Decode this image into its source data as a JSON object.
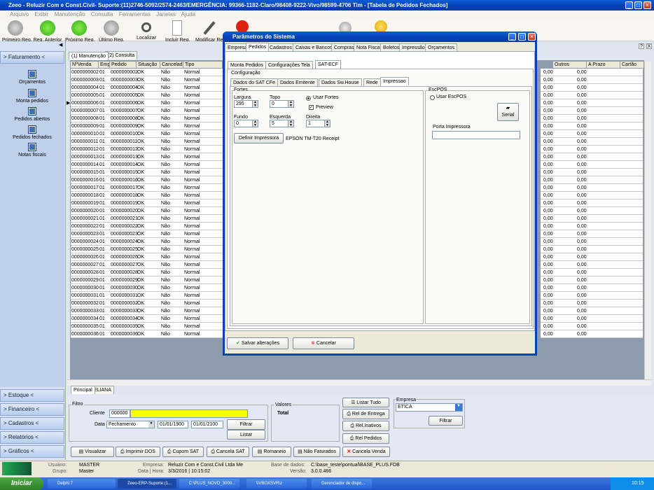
{
  "window": {
    "title": "Zeeo - Reluzir Com e Const.Civil- Suporte:(11)2746-5092/2574-2463/EMERGÊNCIA: 99366-1182-Claro/98408-9222-Vivo/98599-4706 Tim - [Tabela de Pedidos Fechados]"
  },
  "menu": [
    "Arquivo",
    "Exibir",
    "Manutenção",
    "Consulta",
    "Ferramentas",
    "Janelas",
    "Ajuda"
  ],
  "toolbar": [
    "Primeiro Reg.",
    "Reg. Anterior",
    "Próximo Reg.",
    "Último Reg.",
    "Localizar",
    "Incluir Reg.",
    "Modificar Reg"
  ],
  "sidebar": {
    "header": "> Faturamento <",
    "items": [
      "Orçamentos",
      "Monta pedidos",
      "Pedidos abertos",
      "Pedidos fechados",
      "Notas fiscais"
    ],
    "bottom": [
      "> Estoque <",
      "> Financeiro <",
      "> Cadastros <",
      "> Relatórios <",
      "> Gráficos <"
    ]
  },
  "main_tabs": [
    "(1) Manutenção",
    "(2) Consulta"
  ],
  "grid": {
    "columns": [
      "NºVenda",
      "Emp",
      "Pedido",
      "Situação",
      "Cancelada",
      "Tipo"
    ],
    "rows": [
      [
        "0000000002",
        "01",
        "0000000002",
        "OK",
        "Não",
        "Normal"
      ],
      [
        "0000000003",
        "01",
        "0000000003",
        "OK",
        "Não",
        "Normal"
      ],
      [
        "0000000004",
        "01",
        "0000000004",
        "OK",
        "Não",
        "Normal"
      ],
      [
        "0000000005",
        "01",
        "0000000005",
        "OK",
        "Não",
        "Normal"
      ],
      [
        "0000000006",
        "01",
        "0000000006",
        "OK",
        "Não",
        "Normal"
      ],
      [
        "0000000007",
        "01",
        "0000000007",
        "OK",
        "Não",
        "Normal"
      ],
      [
        "0000000008",
        "01",
        "0000000008",
        "OK",
        "Não",
        "Normal"
      ],
      [
        "0000000009",
        "01",
        "0000000009",
        "OK",
        "Não",
        "Normal"
      ],
      [
        "0000000010",
        "01",
        "0000000010",
        "OK",
        "Não",
        "Normal"
      ],
      [
        "0000000011",
        "01",
        "0000000011",
        "OK",
        "Não",
        "Normal"
      ],
      [
        "0000000012",
        "01",
        "0000000012",
        "OK",
        "Não",
        "Normal"
      ],
      [
        "0000000013",
        "01",
        "0000000013",
        "OK",
        "Não",
        "Normal"
      ],
      [
        "0000000014",
        "01",
        "0000000014",
        "OK",
        "Não",
        "Normal"
      ],
      [
        "0000000015",
        "01",
        "0000000015",
        "OK",
        "Não",
        "Normal"
      ],
      [
        "0000000016",
        "01",
        "0000000016",
        "OK",
        "Não",
        "Normal"
      ],
      [
        "0000000017",
        "01",
        "0000000017",
        "OK",
        "Não",
        "Normal"
      ],
      [
        "0000000018",
        "01",
        "0000000018",
        "OK",
        "Não",
        "Normal"
      ],
      [
        "0000000019",
        "01",
        "0000000019",
        "OK",
        "Não",
        "Normal"
      ],
      [
        "0000000020",
        "01",
        "0000000020",
        "OK",
        "Não",
        "Normal"
      ],
      [
        "0000000021",
        "01",
        "0000000021",
        "OK",
        "Não",
        "Normal"
      ],
      [
        "0000000022",
        "01",
        "0000000022",
        "OK",
        "Não",
        "Normal"
      ],
      [
        "0000000023",
        "01",
        "0000000023",
        "OK",
        "Não",
        "Normal"
      ],
      [
        "0000000024",
        "01",
        "0000000024",
        "OK",
        "Não",
        "Normal"
      ],
      [
        "0000000025",
        "01",
        "0000000025",
        "OK",
        "Não",
        "Normal"
      ],
      [
        "0000000026",
        "01",
        "0000000026",
        "OK",
        "Não",
        "Normal"
      ],
      [
        "0000000027",
        "01",
        "0000000027",
        "OK",
        "Não",
        "Normal"
      ],
      [
        "0000000028",
        "01",
        "0000000028",
        "OK",
        "Não",
        "Normal"
      ],
      [
        "0000000029",
        "01",
        "0000000029",
        "OK",
        "Não",
        "Normal"
      ],
      [
        "0000000030",
        "01",
        "0000000030",
        "OK",
        "Não",
        "Normal"
      ],
      [
        "0000000031",
        "01",
        "0000000031",
        "OK",
        "Não",
        "Normal"
      ],
      [
        "0000000032",
        "01",
        "0000000032",
        "OK",
        "Não",
        "Normal"
      ],
      [
        "0000000033",
        "01",
        "0000000033",
        "OK",
        "Não",
        "Normal"
      ],
      [
        "0000000034",
        "01",
        "0000000034",
        "OK",
        "Não",
        "Normal"
      ],
      [
        "0000000035",
        "01",
        "0000000035",
        "OK",
        "Não",
        "Normal"
      ],
      [
        "0000000036",
        "01",
        "0000000036",
        "OK",
        "Não",
        "Normal"
      ]
    ]
  },
  "right_grid": {
    "columns": [
      "Outros",
      "A Prazo",
      "Cartão"
    ],
    "value": "0,00"
  },
  "sheet_tabs": [
    "Principal",
    "ELIANA"
  ],
  "filter": {
    "title": "Filtro",
    "cliente_label": "Cliente",
    "cliente_value": "000000",
    "data_label": "Data",
    "data_select": "Fechamento",
    "date_from": "01/01/1900",
    "date_to": "01/01/2100",
    "filtrar": "Filtrar",
    "listar": "Listar"
  },
  "valores": {
    "title": "Valores",
    "total": "Total"
  },
  "actions": {
    "listar_tudo": "Listar Tudo",
    "rel_entrega": "Rel de Entrega",
    "rel_inativos": "Rel.Inativos",
    "rel_pedidos": "Rel Pedidos"
  },
  "empresa": {
    "title": "Empresa",
    "value": "ETICA",
    "filtrar": "Filtrar"
  },
  "bottom_buttons": [
    "Visualizar",
    "Imprimir DOS",
    "Cupom SAT",
    "Cancela SAT",
    "Romaneio",
    "Não Faturados",
    "Cancela Venda"
  ],
  "status": {
    "usuario_label": "Usuário:",
    "usuario": "MASTER",
    "grupo_label": "Grupo:",
    "grupo": "Master",
    "empresa_label": "Empresa:",
    "empresa": "Reluzir Com e Const.Civil Ltda Me",
    "data_label": "Data | Hora:",
    "data": "3/3/2016 | 10:15:02",
    "base_label": "Base de dados:",
    "base": "C:\\base_teste\\pontual\\BASE_PLUS.FDB",
    "versao_label": "Versão:",
    "versao": "3.0.0.466"
  },
  "taskbar": {
    "start": "Iniciar",
    "items": [
      "Delphi 7",
      "Zeeo-ERP-Suporte:(1...",
      "C:\\PLUS_NOVO_3000...",
      "\\\\VBOXSVR\\z",
      "Gerenciador de dispo..."
    ],
    "clock": "10:15"
  },
  "dialog": {
    "title": "Parâmetros do Sistema",
    "tabs": [
      "Empresa",
      "Pedidos",
      "Cadastros",
      "Caixas e Bancos",
      "Compras",
      "Nota Fiscal",
      "Boletos",
      "Impressão",
      "Orçamentos"
    ],
    "subtabs": [
      "Monta Pedidos",
      "Configurações Tela",
      "SAT-ECF"
    ],
    "config_label": "Configuração",
    "config_tabs": [
      "Dados do SAT CFe",
      "Dados Emitente",
      "Dados Sw.House",
      "Rede",
      "Impressao"
    ],
    "fortes": {
      "title": "Fortes",
      "largura_label": "Largura",
      "largura": "295",
      "topo_label": "Topo",
      "topo": "0",
      "fundo_label": "Fundo",
      "fundo": "0",
      "esquerda_label": "Esquerda",
      "esquerda": "5",
      "direita_label": "Direita",
      "direita": "1",
      "usar_fortes": "Usar Fortes",
      "preview": "Preview",
      "definir": "Definir Impressora",
      "printer": "EPSON TM-T20 Receipt"
    },
    "escpos": {
      "title": "EscPOS",
      "usar": "Usar EscPOS",
      "serial": "Serial",
      "porta_label": "Porta Impressora"
    },
    "salvar": "Salvar alterações",
    "cancelar": "Cancelar"
  },
  "help_badge": "?",
  "colors": {
    "titlebar": "#0842b8",
    "highlight": "#ffff00",
    "accent": "#3d6fb8"
  }
}
